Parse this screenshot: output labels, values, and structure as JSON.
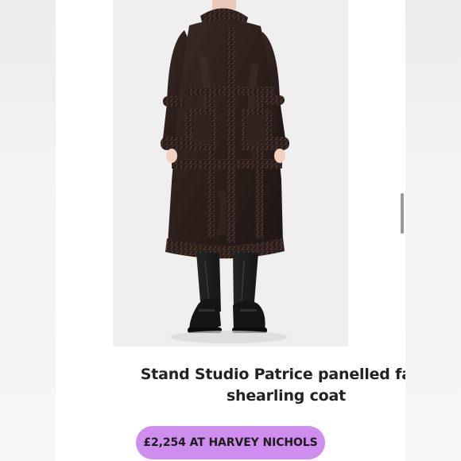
{
  "product": {
    "title_line_1": "Stand Studio Patrice panelled faux",
    "title_line_2": "shearling coat"
  },
  "cta": {
    "label": "£2,254 AT HARVEY NICHOLS"
  },
  "theme": {
    "page_background": "#ffffff",
    "outer_background": "#f3f3f3",
    "button_color": "#d08df0",
    "text_color": "#222222",
    "scrollbar_color": "#8d8d8d"
  }
}
